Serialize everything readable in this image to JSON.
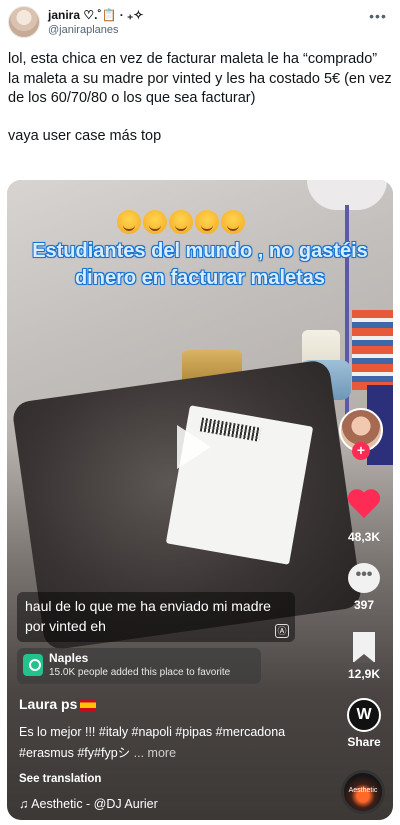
{
  "tweet": {
    "display_name": "janira ♡.˚📋 · ₊✧",
    "handle": "@janiraplanes",
    "more_icon": "more-icon",
    "text_line1": "lol, esta chica en vez de facturar maleta le ha “comprado” la maleta a su madre por vinted y les ha costado 5€ (en vez de los 60/70/80 o los que sea facturar)",
    "text_line2": "vaya user case más top"
  },
  "video": {
    "overlay_emojis": "☺️☺️☺️☺️☺️",
    "overlay_title": "Estudiantes del mundo , no gastéis dinero en facturar maletas",
    "caption": "haul de lo que me ha enviado mi madre por vinted eh",
    "caption_icon": "Ⓐ",
    "place": {
      "name": "Naples",
      "subtitle": "15.0K people added this place to favorite"
    },
    "author": "Laura ps",
    "description": "Es lo mejor !!! #italy #napoli #pipas #mercadona #erasmus #fy#fypシ",
    "more_label": "... more",
    "see_translation": "See translation",
    "music": "♫ Aesthetic - @DJ Aurier",
    "rail": {
      "follow_plus": "+",
      "likes": "48,3K",
      "comments_icon": "•••",
      "comments": "397",
      "saves": "12,9K",
      "share_logo": "W",
      "share_label": "Share",
      "disc_label": "Aesthetic"
    },
    "colors": {
      "accent_red": "#fe2c55",
      "overlay_text": "#d7ecff",
      "overlay_stroke": "#1a74d2",
      "place_icon": "#21c28c"
    }
  }
}
